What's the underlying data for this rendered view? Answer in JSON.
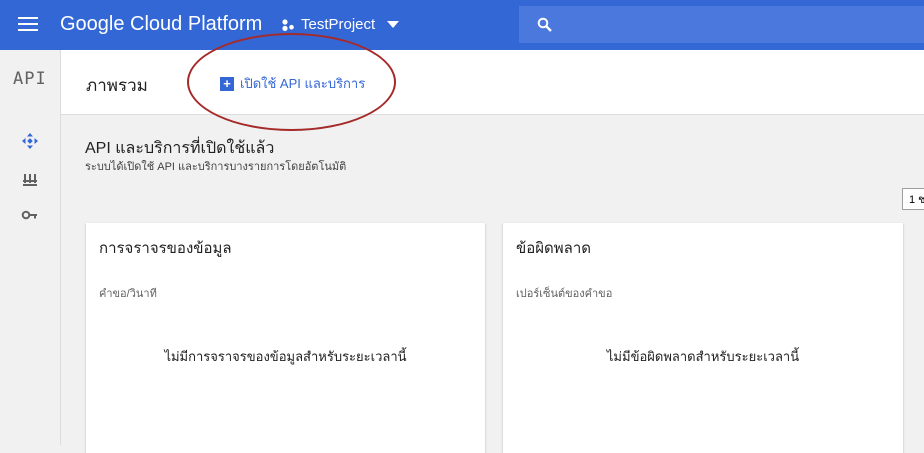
{
  "topbar": {
    "app_title": "Google Cloud Platform",
    "project_name": "TestProject",
    "icons": [
      "menu-icon",
      "project-dots-icon",
      "dropdown-arrow-icon",
      "search-icon"
    ],
    "color": "#3367d6"
  },
  "sidebar": {
    "logo": "API",
    "items": [
      {
        "icon": "api-dashboard-icon",
        "active": true
      },
      {
        "icon": "library-icon",
        "active": false
      },
      {
        "icon": "key-icon",
        "active": false
      }
    ]
  },
  "header": {
    "title": "ภาพรวม",
    "enable_button_label": "เปิดใช้ API และบริการ",
    "annotation_color": "#a52a2a"
  },
  "main": {
    "section_title": "API และบริการที่เปิดใช้แล้ว",
    "section_subtitle": "ระบบได้เปิดใช้ API และบริการบางรายการโดยอัตโนมัติ",
    "time_range_value": "1 ช"
  },
  "cards": [
    {
      "title": "การจราจรของข้อมูล",
      "metric_label": "คำขอ/วินาที",
      "empty_message": "ไม่มีการจราจรของข้อมูลสำหรับระยะเวลานี้"
    },
    {
      "title": "ข้อผิดพลาด",
      "metric_label": "เปอร์เซ็นต์ของคำขอ",
      "empty_message": "ไม่มีข้อผิดพลาดสำหรับระยะเวลานี้"
    }
  ]
}
